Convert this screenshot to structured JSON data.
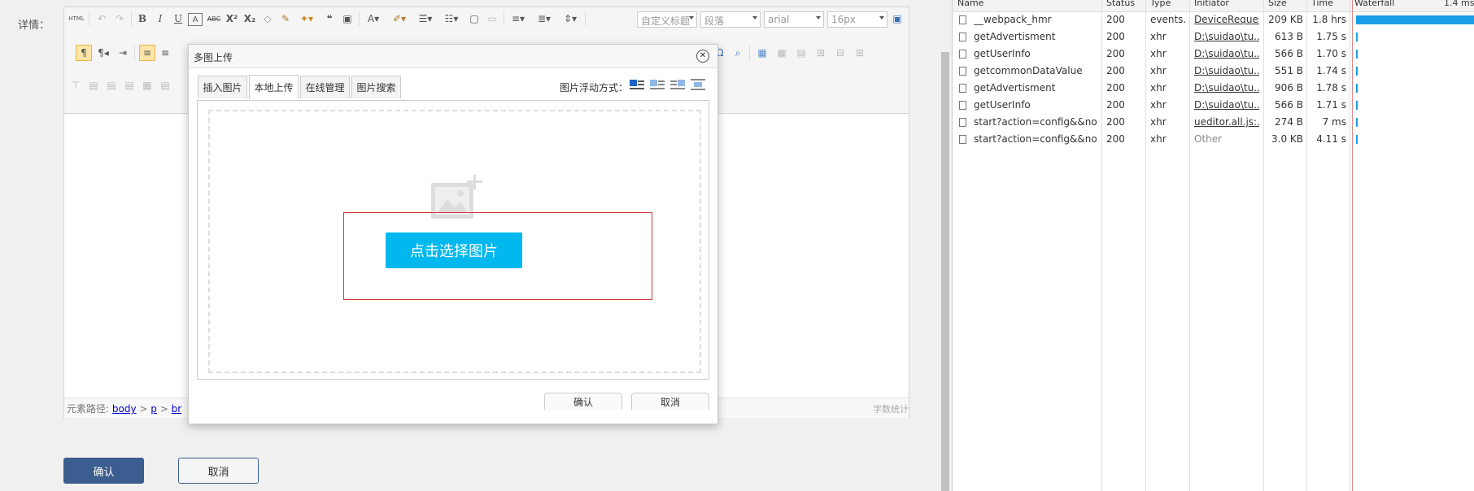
{
  "form": {
    "detail_label": "详情：",
    "confirm_label": "确认",
    "cancel_label": "取消"
  },
  "editor": {
    "toolbar": {
      "html_label": "HTML",
      "bold": "B",
      "italic": "I",
      "underline": "U",
      "strikethrough": "ABC",
      "superscript": "X²",
      "subscript": "X₂",
      "quote": "❝",
      "font_color": "A",
      "heading_select": "自定义标题",
      "paragraph_select": "段落",
      "font_select": "arial",
      "size_select": "16px",
      "omega": "Ω"
    },
    "statusbar": {
      "path_label": "元素路径:",
      "path_body": "body",
      "path_sep1": ">",
      "path_p": "p",
      "path_sep2": ">",
      "path_br": "br",
      "wordcount": "字数统计"
    }
  },
  "modal": {
    "title": "多图上传",
    "close_glyph": "✕",
    "tabs": [
      {
        "label": "插入图片",
        "active": false
      },
      {
        "label": "本地上传",
        "active": true
      },
      {
        "label": "在线管理",
        "active": false
      },
      {
        "label": "图片搜索",
        "active": false
      }
    ],
    "float_label": "图片浮动方式：",
    "pick_button": "点击选择图片",
    "ok_button": "确认",
    "cancel_button": "取消",
    "highlight_color": "#dd3333",
    "pick_color": "#00b7ee"
  },
  "devtools": {
    "headers": {
      "name": "Name",
      "status": "Status",
      "type": "Type",
      "initiator": "Initiator",
      "size": "Size",
      "time": "Time",
      "waterfall": "Waterfall",
      "scale": "1.4 ms"
    },
    "rows": [
      {
        "name": "__webpack_hmr",
        "status": "200",
        "type": "events...",
        "initiator": "DeviceRequest",
        "size": "209 KB",
        "time": "1.8 hrs"
      },
      {
        "name": "getAdvertisment",
        "status": "200",
        "type": "xhr",
        "initiator": "D:\\suidao\\tu...",
        "size": "613 B",
        "time": "1.75 s"
      },
      {
        "name": "getUserInfo",
        "status": "200",
        "type": "xhr",
        "initiator": "D:\\suidao\\tu...",
        "size": "566 B",
        "time": "1.70 s"
      },
      {
        "name": "getcommonDataValue",
        "status": "200",
        "type": "xhr",
        "initiator": "D:\\suidao\\tu...",
        "size": "551 B",
        "time": "1.74 s"
      },
      {
        "name": "getAdvertisment",
        "status": "200",
        "type": "xhr",
        "initiator": "D:\\suidao\\tu...",
        "size": "906 B",
        "time": "1.78 s"
      },
      {
        "name": "getUserInfo",
        "status": "200",
        "type": "xhr",
        "initiator": "D:\\suidao\\tu...",
        "size": "566 B",
        "time": "1.71 s"
      },
      {
        "name": "start?action=config&&noC...",
        "status": "200",
        "type": "xhr",
        "initiator": "ueditor.all.js:...",
        "size": "274 B",
        "time": "7 ms"
      },
      {
        "name": "start?action=config&&noC...",
        "status": "200",
        "type": "xhr",
        "initiator": "Other",
        "size": "3.0 KB",
        "time": "4.11 s"
      }
    ],
    "waterfall_color": "#1a9fe8"
  }
}
